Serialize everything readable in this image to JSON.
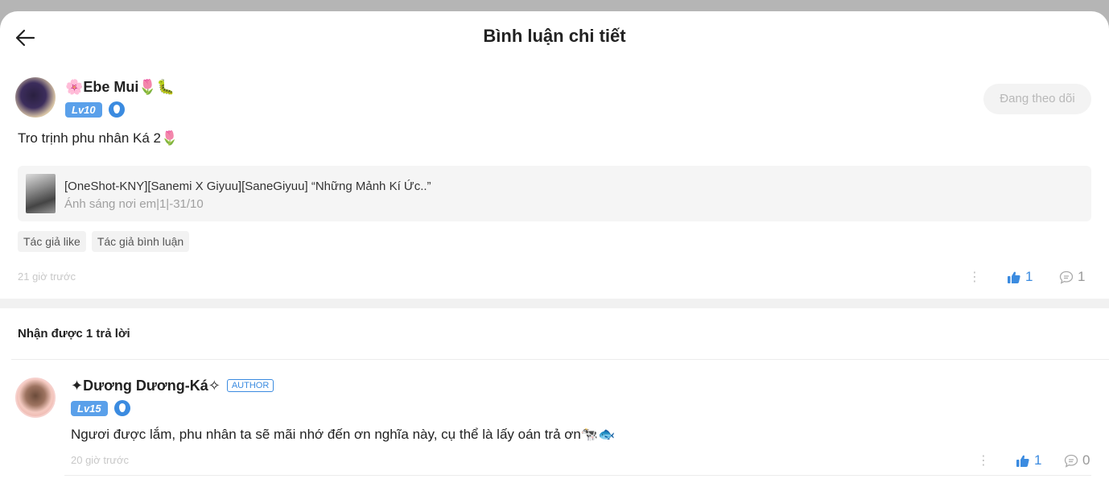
{
  "header": {
    "title": "Bình luận chi tiết",
    "back_icon": "arrow-left-icon"
  },
  "comment": {
    "user_name": "🌸Ebe Mui🌷🐛",
    "level": "Lv10",
    "follow_label": "Đang theo dõi",
    "text": "Tro trịnh phu nhân Ká 2🌷",
    "book": {
      "title": "[OneShot-KNY][Sanemi X Giyuu][SaneGiyuu] “Những Mảnh Kí Ức..”",
      "subtitle": "Ánh sáng nơi em|1|-31/10"
    },
    "tags": [
      "Tác giả like",
      "Tác giả bình luận"
    ],
    "time": "21 giờ trước",
    "likes": "1",
    "replies": "1"
  },
  "replies_header": "Nhận được 1 trả lời",
  "reply": {
    "user_name": "✦Dương Dương-Ká✧",
    "author_badge": "AUTHOR",
    "level": "Lv15",
    "text": "Ngươi được lắm, phu nhân ta sẽ mãi nhớ đến ơn nghĩa này, cụ thể là lấy oán trả ơn🐄🐟",
    "time": "20 giờ trước",
    "likes": "1",
    "replies": "0"
  },
  "colors": {
    "accent": "#3b8be0",
    "level_badge": "#5aa0ea",
    "muted": "#c8c8c8"
  }
}
